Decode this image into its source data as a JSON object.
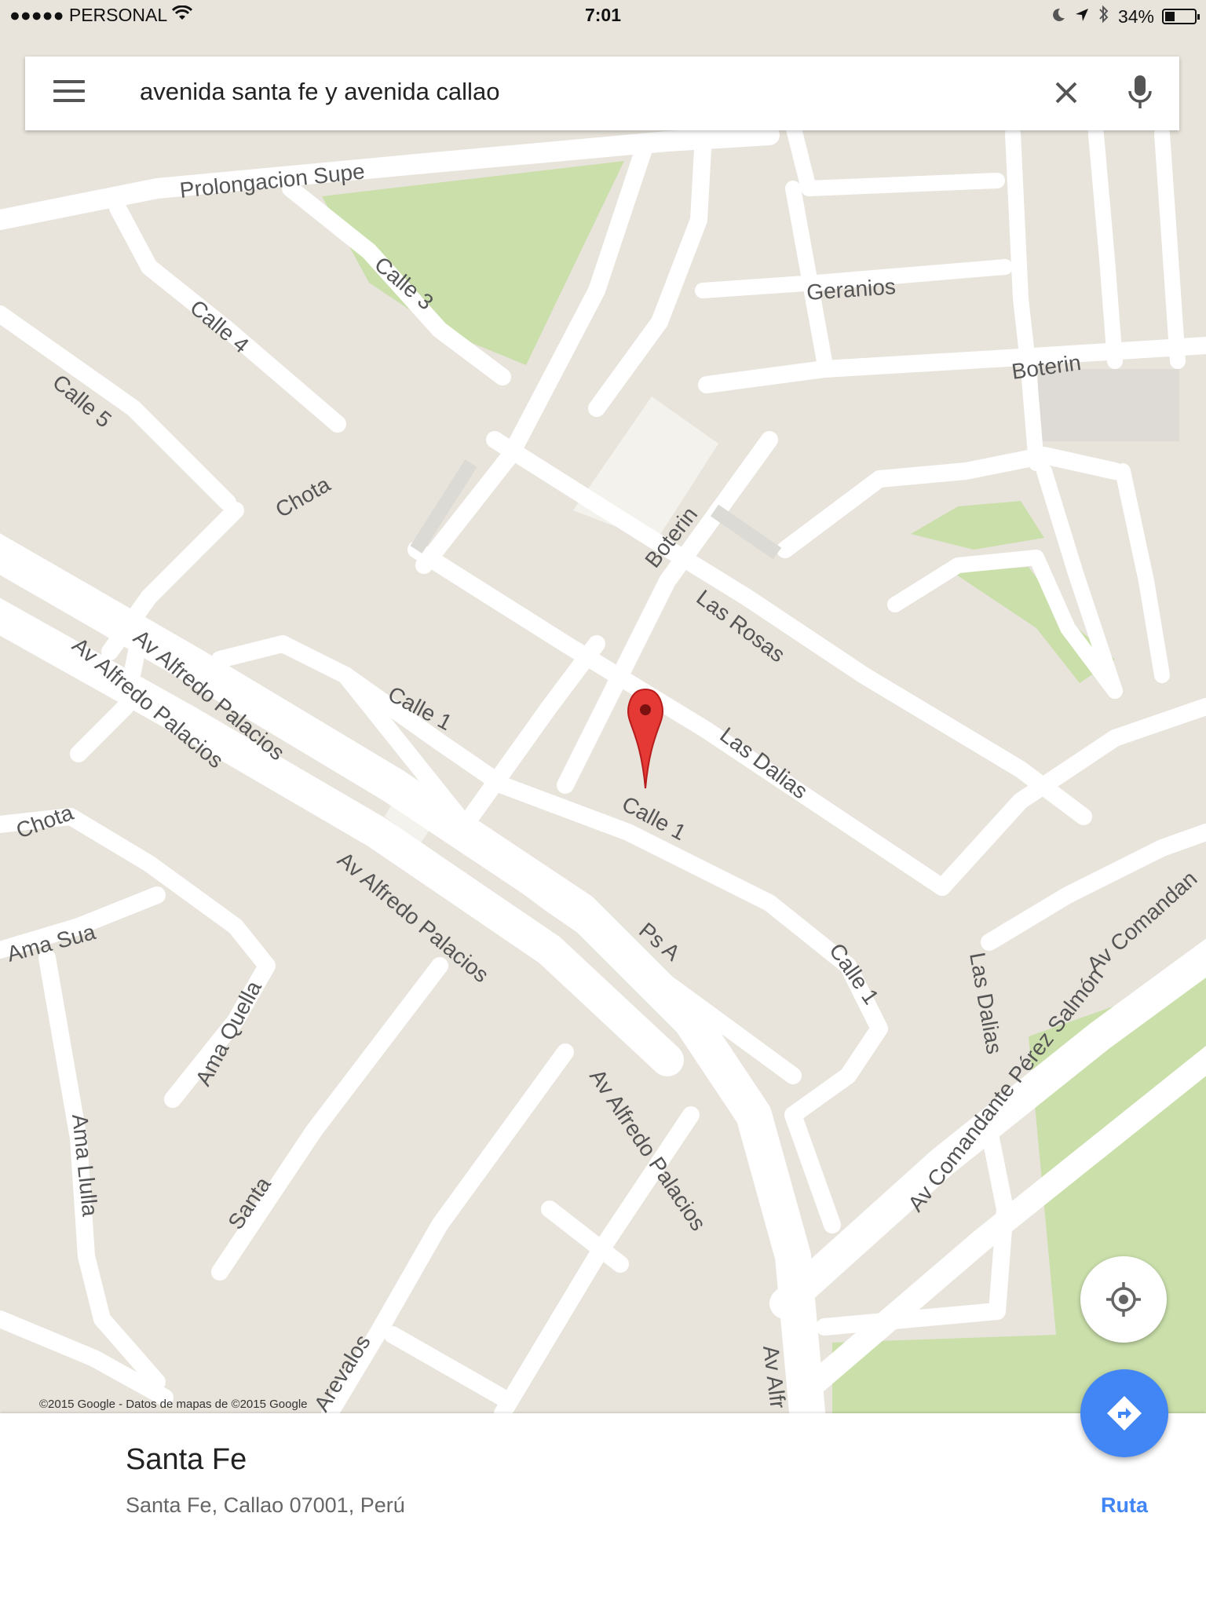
{
  "status_bar": {
    "carrier": "●●●●● PERSONAL",
    "time": "7:01",
    "battery": "34%",
    "battery_level": 0.34
  },
  "search": {
    "query": "avenida santa fe y avenida callao"
  },
  "map": {
    "streets": {
      "prolongacion_supe": "Prolongacion Supe",
      "calle_3": "Calle 3",
      "calle_4": "Calle 4",
      "calle_5": "Calle 5",
      "chota_1": "Chota",
      "chota_2": "Chota",
      "geranios": "Geranios",
      "boterin_1": "Boterin",
      "boterin_2": "Boterin",
      "las_rosas": "Las Rosas",
      "las_dalias_1": "Las Dalias",
      "las_dalias_2": "Las Dalias",
      "calle_1_a": "Calle 1",
      "calle_1_b": "Calle 1",
      "calle_1_c": "Calle 1",
      "av_alfredo_palacios_1": "Av Alfredo Palacios",
      "av_alfredo_palacios_2": "Av Alfredo Palacios",
      "av_alfredo_palacios_3": "Av Alfredo Palacios",
      "av_alfredo_palacios_4": "Av Alfredo Palacios",
      "av_alfr": "Av Alfr",
      "ps_a": "Ps A",
      "ama_sua": "Ama Sua",
      "ama_quella": "Ama Quella",
      "ama_llulla": "Ama Llulla",
      "santa": "Santa",
      "arevalos": "Arevalos",
      "av_comandante_perez_salmon": "Av Comandante Pérez Salmón",
      "av_comandan": "Av Comandan"
    },
    "attribution": "©2015 Google - Datos de mapas de ©2015 Google"
  },
  "place": {
    "name": "Santa Fe",
    "address": "Santa Fe, Callao 07001, Perú"
  },
  "actions": {
    "route_label": "Ruta"
  },
  "colors": {
    "map_background": "#e8e4dc",
    "road": "#ffffff",
    "park": "#cadfaa",
    "pin": "#e53935",
    "accent": "#4285f4"
  }
}
